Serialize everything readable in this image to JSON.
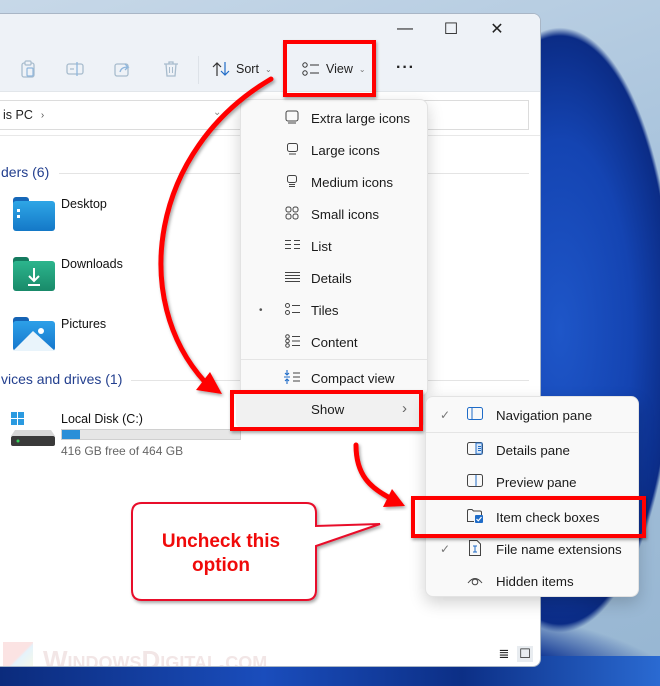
{
  "window": {
    "controls": {
      "minimize": "—",
      "maximize": "☐",
      "close": "✕"
    }
  },
  "toolbar": {
    "icons": [
      "copy-icon",
      "rename-icon",
      "share-icon",
      "delete-icon"
    ],
    "sort_label": "Sort",
    "view_label": "View",
    "more_label": "···"
  },
  "address": {
    "crumb": "is PC",
    "crumb_sep": "›",
    "dropdown": "⌄"
  },
  "content": {
    "folders_header": "ders (6)",
    "folders": [
      {
        "name": "Desktop",
        "color": "#1b86d6"
      },
      {
        "name": "Downloads",
        "color": "#1e9d77"
      },
      {
        "name": "Pictures",
        "color": "#1b7fd4"
      }
    ],
    "devices_header": "vices and drives (1)",
    "drive": {
      "name": "Local Disk (C:)",
      "free_text": "416 GB free of 464 GB",
      "used_fraction": 0.1034
    }
  },
  "view_menu": {
    "items": [
      {
        "label": "Extra large icons",
        "icon": "extra-large-icons-icon",
        "glyph": "▭"
      },
      {
        "label": "Large icons",
        "icon": "large-icons-icon",
        "glyph": "▭"
      },
      {
        "label": "Medium icons",
        "icon": "medium-icons-icon",
        "glyph": "⌂"
      },
      {
        "label": "Small icons",
        "icon": "small-icons-icon",
        "glyph": "88"
      },
      {
        "label": "List",
        "icon": "list-icon",
        "glyph": "☰"
      },
      {
        "label": "Details",
        "icon": "details-icon",
        "glyph": "≣"
      },
      {
        "label": "Tiles",
        "icon": "tiles-icon",
        "glyph": "☷",
        "selected": true
      },
      {
        "label": "Content",
        "icon": "content-icon",
        "glyph": "☷"
      }
    ],
    "compact_view": "Compact view",
    "show": "Show",
    "show_chevron": "›",
    "bullet": "•"
  },
  "show_submenu": {
    "items": [
      {
        "label": "Navigation pane",
        "checked": true
      },
      {
        "label": "Details pane",
        "checked": false
      },
      {
        "label": "Preview pane",
        "checked": false
      },
      {
        "label": "Item check boxes",
        "checked": false
      },
      {
        "label": "File name extensions",
        "checked": true
      },
      {
        "label": "Hidden items",
        "checked": false
      }
    ],
    "check_glyph": "✓"
  },
  "annotation": {
    "callout_line1": "Uncheck this",
    "callout_line2": "option",
    "color": "#ff0000"
  },
  "watermark": {
    "text": "WindowsDigital.com"
  },
  "status_bar": {
    "details_view": "≣",
    "tiles_view": "☐"
  }
}
